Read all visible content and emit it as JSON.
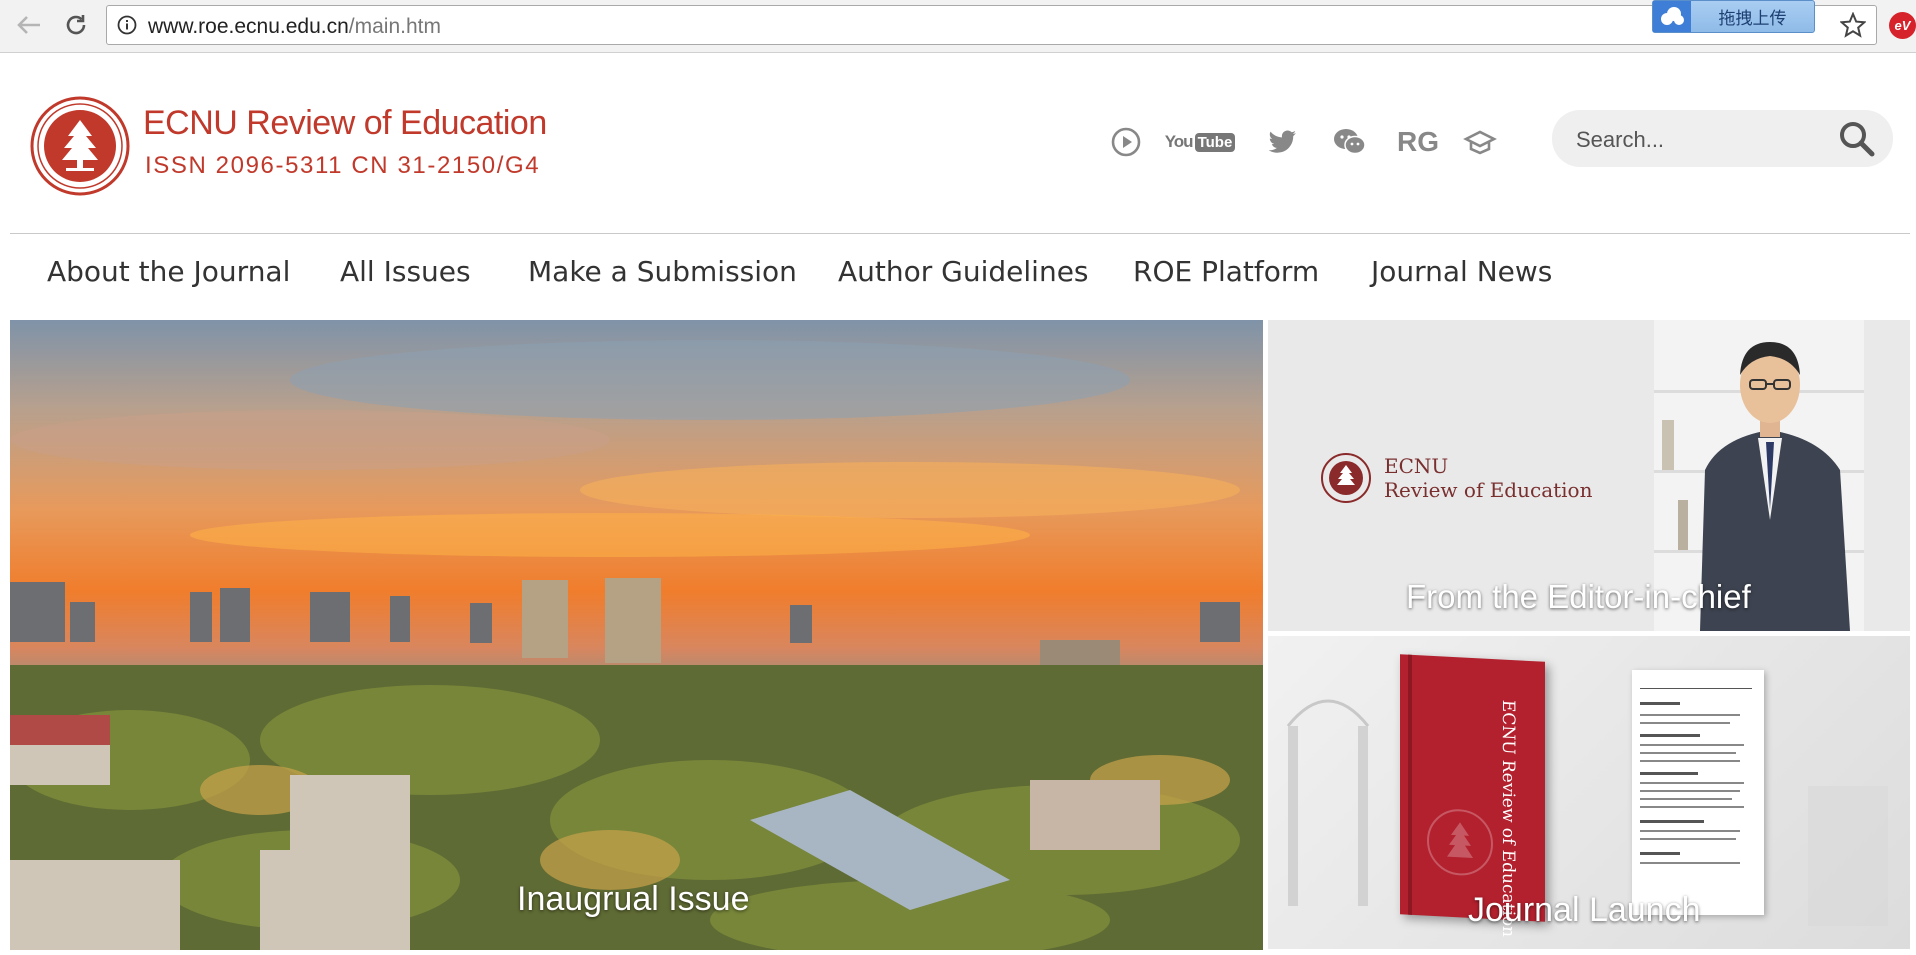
{
  "browser": {
    "url_host": "www.roe.ecnu.edu.cn",
    "url_path": "/main.htm",
    "upload_label": "拖拽上传",
    "extension_label": "eV"
  },
  "header": {
    "title": "ECNU Review of Education",
    "issn": "ISSN 2096-5311 CN 31-2150/G4",
    "social_icons": [
      "play-circle-icon",
      "youtube-icon",
      "twitter-icon",
      "wechat-icon",
      "researchgate-icon",
      "mendeley-icon"
    ],
    "rg_label": "RG",
    "youtube_label_you": "You",
    "youtube_label_tube": "Tube",
    "search_placeholder": "Search..."
  },
  "nav": {
    "items": [
      {
        "label": "About the Journal"
      },
      {
        "label": "All Issues"
      },
      {
        "label": "Make a Submission"
      },
      {
        "label": "Author Guidelines"
      },
      {
        "label": "ROE Platform"
      },
      {
        "label": "Journal News"
      }
    ]
  },
  "tiles": {
    "main_caption": "Inaugrual Issue",
    "editor_caption": "From the Editor-in-chief",
    "editor_logo_line1": "ECNU",
    "editor_logo_line2": "Review of Education",
    "launch_caption": "Journal Launch",
    "book_spine_title": "ECNU Review of Education"
  },
  "colors": {
    "brand": "#c0392b",
    "nav_text": "#333333",
    "search_bg": "#efefef",
    "book_red": "#b3202e"
  }
}
